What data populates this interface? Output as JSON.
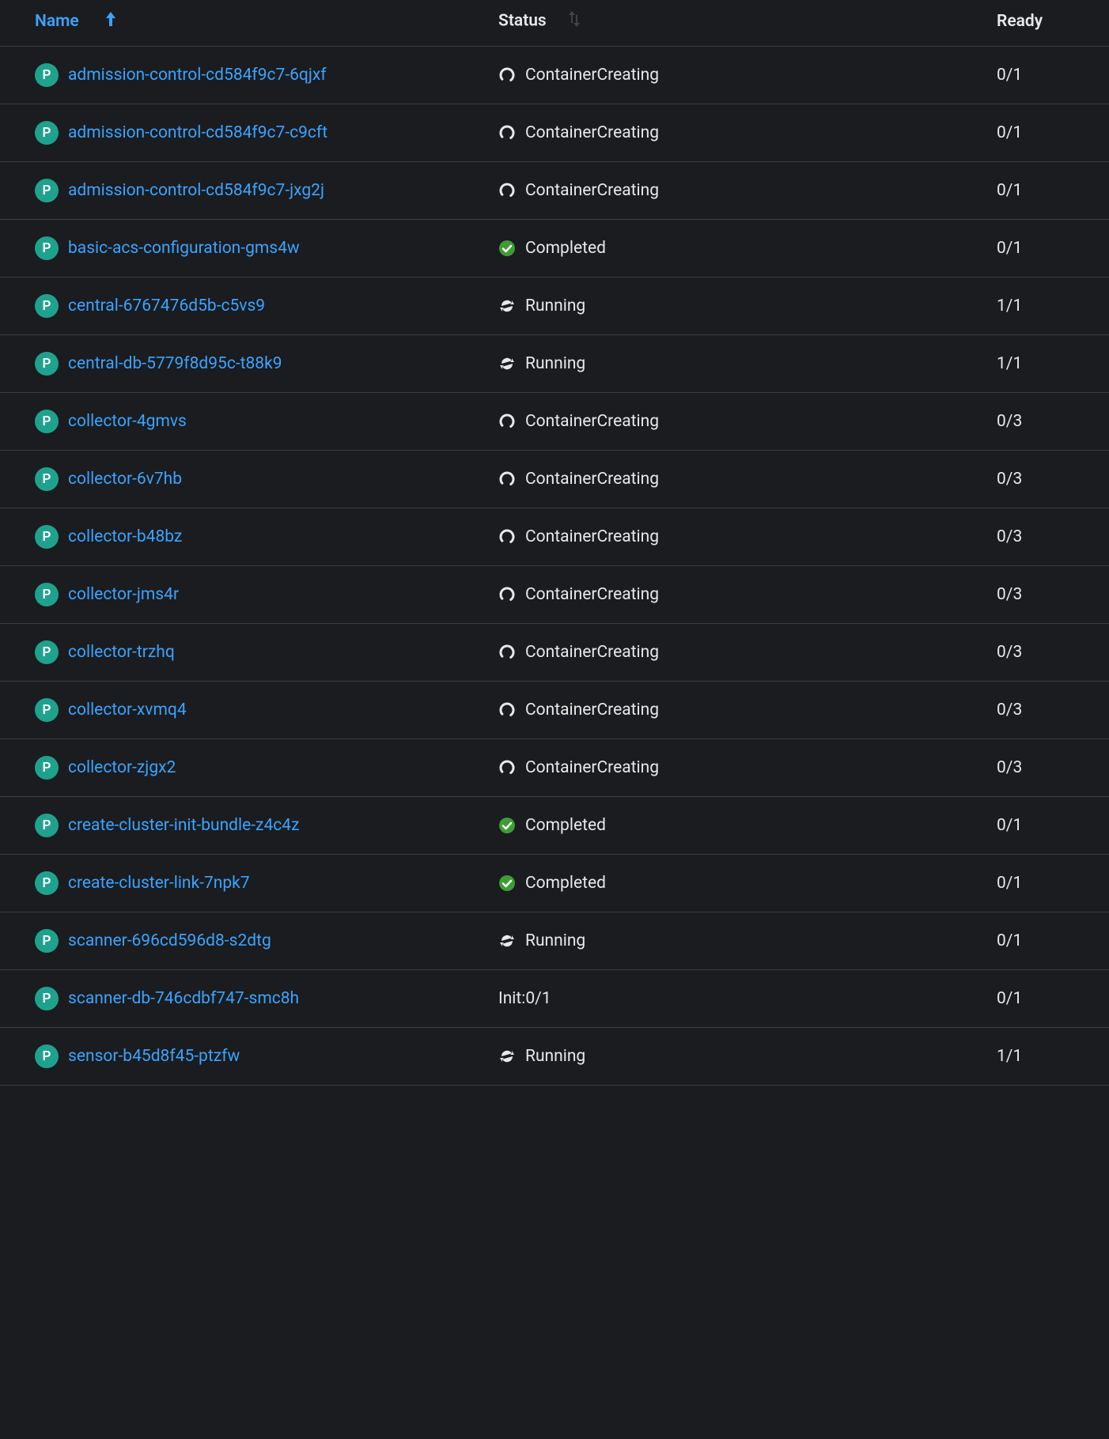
{
  "columns": {
    "name": "Name",
    "status": "Status",
    "ready": "Ready"
  },
  "badge_letter": "P",
  "rows": [
    {
      "name": "admission-control-cd584f9c7-6qjxf",
      "status": "ContainerCreating",
      "status_icon": "spinner",
      "ready": "0/1"
    },
    {
      "name": "admission-control-cd584f9c7-c9cft",
      "status": "ContainerCreating",
      "status_icon": "spinner",
      "ready": "0/1"
    },
    {
      "name": "admission-control-cd584f9c7-jxg2j",
      "status": "ContainerCreating",
      "status_icon": "spinner",
      "ready": "0/1"
    },
    {
      "name": "basic-acs-configuration-gms4w",
      "status": "Completed",
      "status_icon": "check",
      "ready": "0/1"
    },
    {
      "name": "central-6767476d5b-c5vs9",
      "status": "Running",
      "status_icon": "sync",
      "ready": "1/1"
    },
    {
      "name": "central-db-5779f8d95c-t88k9",
      "status": "Running",
      "status_icon": "sync",
      "ready": "1/1"
    },
    {
      "name": "collector-4gmvs",
      "status": "ContainerCreating",
      "status_icon": "spinner",
      "ready": "0/3"
    },
    {
      "name": "collector-6v7hb",
      "status": "ContainerCreating",
      "status_icon": "spinner",
      "ready": "0/3"
    },
    {
      "name": "collector-b48bz",
      "status": "ContainerCreating",
      "status_icon": "spinner",
      "ready": "0/3"
    },
    {
      "name": "collector-jms4r",
      "status": "ContainerCreating",
      "status_icon": "spinner",
      "ready": "0/3"
    },
    {
      "name": "collector-trzhq",
      "status": "ContainerCreating",
      "status_icon": "spinner",
      "ready": "0/3"
    },
    {
      "name": "collector-xvmq4",
      "status": "ContainerCreating",
      "status_icon": "spinner",
      "ready": "0/3"
    },
    {
      "name": "collector-zjgx2",
      "status": "ContainerCreating",
      "status_icon": "spinner",
      "ready": "0/3"
    },
    {
      "name": "create-cluster-init-bundle-z4c4z",
      "status": "Completed",
      "status_icon": "check",
      "ready": "0/1"
    },
    {
      "name": "create-cluster-link-7npk7",
      "status": "Completed",
      "status_icon": "check",
      "ready": "0/1"
    },
    {
      "name": "scanner-696cd596d8-s2dtg",
      "status": "Running",
      "status_icon": "sync",
      "ready": "0/1"
    },
    {
      "name": "scanner-db-746cdbf747-smc8h",
      "status": "Init:0/1",
      "status_icon": "none",
      "ready": "0/1"
    },
    {
      "name": "sensor-b45d8f45-ptzfw",
      "status": "Running",
      "status_icon": "sync",
      "ready": "1/1"
    }
  ]
}
